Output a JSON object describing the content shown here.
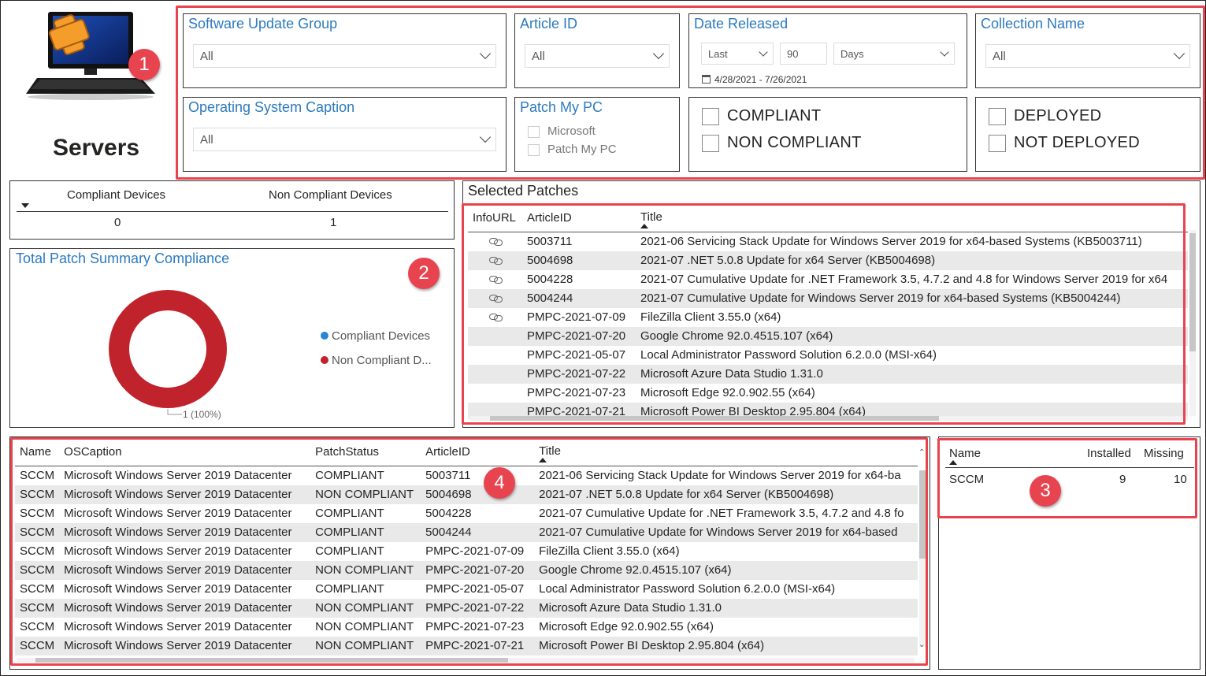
{
  "page_title": "Servers",
  "badges": [
    "1",
    "2",
    "3",
    "4"
  ],
  "slicers": {
    "software_update_group": {
      "title": "Software Update Group",
      "value": "All"
    },
    "article_id": {
      "title": "Article ID",
      "value": "All"
    },
    "date_released": {
      "title": "Date Released",
      "relative": "Last",
      "amount": "90",
      "unit": "Days",
      "range": "4/28/2021 - 7/26/2021"
    },
    "collection_name": {
      "title": "Collection Name",
      "value": "All"
    },
    "operating_system_caption": {
      "title": "Operating System Caption",
      "value": "All"
    },
    "patch_my_pc": {
      "title": "Patch My PC",
      "options": [
        "Microsoft",
        "Patch My PC"
      ]
    },
    "compliance": {
      "options": [
        "COMPLIANT",
        "NON COMPLIANT"
      ]
    },
    "deployment": {
      "options": [
        "DEPLOYED",
        "NOT DEPLOYED"
      ]
    }
  },
  "summary_table": {
    "headers": [
      "Compliant Devices",
      "Non Compliant Devices"
    ],
    "values": [
      "0",
      "1"
    ]
  },
  "donut": {
    "title": "Total Patch Summary Compliance",
    "legend": [
      {
        "label": "Compliant Devices",
        "color": "#2a85d6"
      },
      {
        "label": "Non Compliant D...",
        "color": "#c0232b"
      }
    ],
    "data_label": "1 (100%)"
  },
  "chart_data": {
    "type": "pie",
    "title": "Total Patch Summary Compliance",
    "categories": [
      "Compliant Devices",
      "Non Compliant Devices"
    ],
    "values": [
      0,
      1
    ],
    "data_labels": [
      "",
      "1 (100%)"
    ],
    "legend": "right"
  },
  "selected_patches": {
    "title": "Selected Patches",
    "headers": [
      "InfoURL",
      "ArticleID",
      "Title"
    ],
    "rows": [
      {
        "link": true,
        "id": "5003711",
        "title": "2021-06 Servicing Stack Update for Windows Server 2019 for x64-based Systems (KB5003711)"
      },
      {
        "link": true,
        "id": "5004698",
        "title": "2021-07 .NET 5.0.8 Update for x64 Server (KB5004698)"
      },
      {
        "link": true,
        "id": "5004228",
        "title": "2021-07 Cumulative Update for .NET Framework 3.5, 4.7.2 and 4.8 for Windows Server 2019 for x64"
      },
      {
        "link": true,
        "id": "5004244",
        "title": "2021-07 Cumulative Update for Windows Server 2019 for x64-based Systems (KB5004244)"
      },
      {
        "link": true,
        "id": "PMPC-2021-07-09",
        "title": "FileZilla Client 3.55.0 (x64)"
      },
      {
        "link": false,
        "id": "PMPC-2021-07-20",
        "title": "Google Chrome 92.0.4515.107 (x64)"
      },
      {
        "link": false,
        "id": "PMPC-2021-05-07",
        "title": "Local Administrator Password Solution 6.2.0.0 (MSI-x64)"
      },
      {
        "link": false,
        "id": "PMPC-2021-07-22",
        "title": "Microsoft Azure Data Studio 1.31.0"
      },
      {
        "link": false,
        "id": "PMPC-2021-07-23",
        "title": "Microsoft Edge 92.0.902.55 (x64)"
      },
      {
        "link": false,
        "id": "PMPC-2021-07-21",
        "title": "Microsoft Power BI Desktop 2.95.804 (x64)"
      }
    ]
  },
  "device_patches": {
    "headers": [
      "Name",
      "OSCaption",
      "PatchStatus",
      "ArticleID",
      "Title"
    ],
    "rows": [
      [
        "SCCM",
        "Microsoft Windows Server 2019 Datacenter",
        "COMPLIANT",
        "5003711",
        "2021-06 Servicing Stack Update for Windows Server 2019 for x64-ba"
      ],
      [
        "SCCM",
        "Microsoft Windows Server 2019 Datacenter",
        "NON COMPLIANT",
        "5004698",
        "2021-07 .NET 5.0.8 Update for x64 Server (KB5004698)"
      ],
      [
        "SCCM",
        "Microsoft Windows Server 2019 Datacenter",
        "COMPLIANT",
        "5004228",
        "2021-07 Cumulative Update for .NET Framework 3.5, 4.7.2 and 4.8 fo"
      ],
      [
        "SCCM",
        "Microsoft Windows Server 2019 Datacenter",
        "COMPLIANT",
        "5004244",
        "2021-07 Cumulative Update for Windows Server 2019 for x64-based"
      ],
      [
        "SCCM",
        "Microsoft Windows Server 2019 Datacenter",
        "COMPLIANT",
        "PMPC-2021-07-09",
        "FileZilla Client 3.55.0 (x64)"
      ],
      [
        "SCCM",
        "Microsoft Windows Server 2019 Datacenter",
        "NON COMPLIANT",
        "PMPC-2021-07-20",
        "Google Chrome 92.0.4515.107 (x64)"
      ],
      [
        "SCCM",
        "Microsoft Windows Server 2019 Datacenter",
        "COMPLIANT",
        "PMPC-2021-05-07",
        "Local Administrator Password Solution 6.2.0.0 (MSI-x64)"
      ],
      [
        "SCCM",
        "Microsoft Windows Server 2019 Datacenter",
        "NON COMPLIANT",
        "PMPC-2021-07-22",
        "Microsoft Azure Data Studio 1.31.0"
      ],
      [
        "SCCM",
        "Microsoft Windows Server 2019 Datacenter",
        "NON COMPLIANT",
        "PMPC-2021-07-23",
        "Microsoft Edge 92.0.902.55 (x64)"
      ],
      [
        "SCCM",
        "Microsoft Windows Server 2019 Datacenter",
        "NON COMPLIANT",
        "PMPC-2021-07-21",
        "Microsoft Power BI Desktop 2.95.804 (x64)"
      ]
    ]
  },
  "device_summary": {
    "headers": [
      "Name",
      "Installed",
      "Missing"
    ],
    "rows": [
      [
        "SCCM",
        "9",
        "10"
      ]
    ]
  }
}
